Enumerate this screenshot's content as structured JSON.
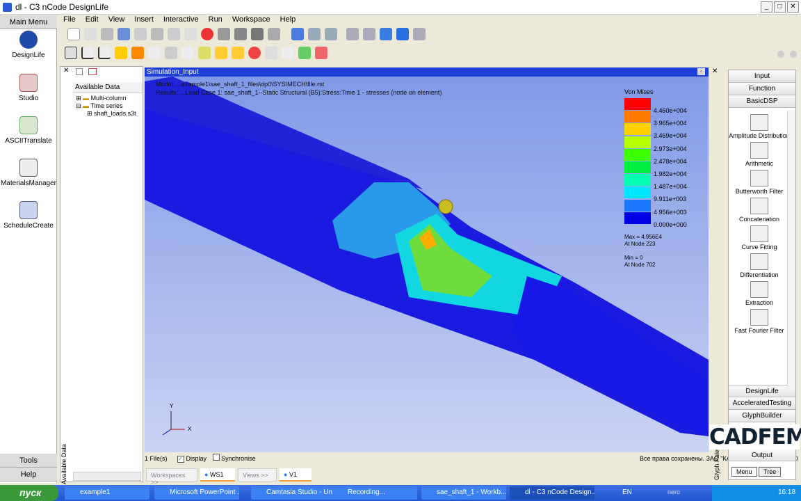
{
  "window": {
    "title": "dl - C3 nCode DesignLife"
  },
  "main_menu": {
    "header": "Main Menu",
    "items": [
      "DesignLife",
      "Studio",
      "ASCIITranslate",
      "MaterialsManager",
      "ScheduleCreate"
    ],
    "tools": "Tools",
    "help": "Help"
  },
  "menubar": [
    "File",
    "Edit",
    "View",
    "Insert",
    "Interactive",
    "Run",
    "Workspace",
    "Help"
  ],
  "data_panel": {
    "title": "Available Data",
    "tree": [
      "Multi-column",
      "Time series",
      "shaft_loads.s3t"
    ],
    "side_label": "Available Data"
  },
  "viewport": {
    "title": "Simulation_Input",
    "line1": "Model: ...example1\\sae_shaft_1_files\\dp0\\SYS\\MECH\\file.rst",
    "line2": "Results: ...Load Case 1: sae_shaft_1--Static Structural (B5):Stress:Time 1 - stresses (node on element)",
    "legend_title": "Von Mises",
    "legend_labels": [
      "4.460e+004",
      "3.965e+004",
      "3.469e+004",
      "2.973e+004",
      "2.478e+004",
      "1.982e+004",
      "1.487e+004",
      "9.911e+003",
      "4.956e+003",
      "0.000e+000"
    ],
    "legend_colors": [
      "#ff0000",
      "#ff7a00",
      "#ffd000",
      "#b6ff00",
      "#3cff00",
      "#00ee40",
      "#00ffb0",
      "#00e6ff",
      "#1a78ff",
      "#0000e6"
    ],
    "max": "Max = 4.956E4",
    "max_node": "At Node 223",
    "min": "Min = 0",
    "min_node": "At Node 702",
    "axis_x": "X",
    "axis_y": "Y"
  },
  "status": {
    "files": "1 File(s)",
    "display": "Display",
    "synchronise": "Synchronise",
    "copyright": "Все права сохранены. ЗАО \"КАДФЕМ Си-Ай-Эс\", 2010"
  },
  "tabs": {
    "workspaces": "Workspaces >>",
    "ws1": "WS1",
    "views": "Views >>",
    "v1": "V1"
  },
  "right_panel": {
    "headers": [
      "Input",
      "Function",
      "BasicDSP"
    ],
    "glyphs": [
      "Amplitude Distribution",
      "Arithmetic",
      "Butterworth Filter",
      "Concatenation",
      "Curve Fitting",
      "Differentiation",
      "Extraction",
      "Fast Fourier Filter"
    ],
    "footers": [
      "DesignLife",
      "AcceleratedTesting",
      "GlyphBuilder",
      "Output"
    ],
    "tab_menu": "Menu",
    "tab_tree": "Tree",
    "side_label": "Glyph Palette"
  },
  "logo": "CADFEM",
  "taskbar": {
    "start": "пуск",
    "items": [
      "example1",
      "Microsoft PowerPoint ...",
      "Camtasia Studio - Unt...",
      "Recording...",
      "sae_shaft_1 - Workb...",
      "dl - C3 nCode Design..."
    ],
    "lang": "EN",
    "nero": "nero",
    "clock": "16:18"
  }
}
